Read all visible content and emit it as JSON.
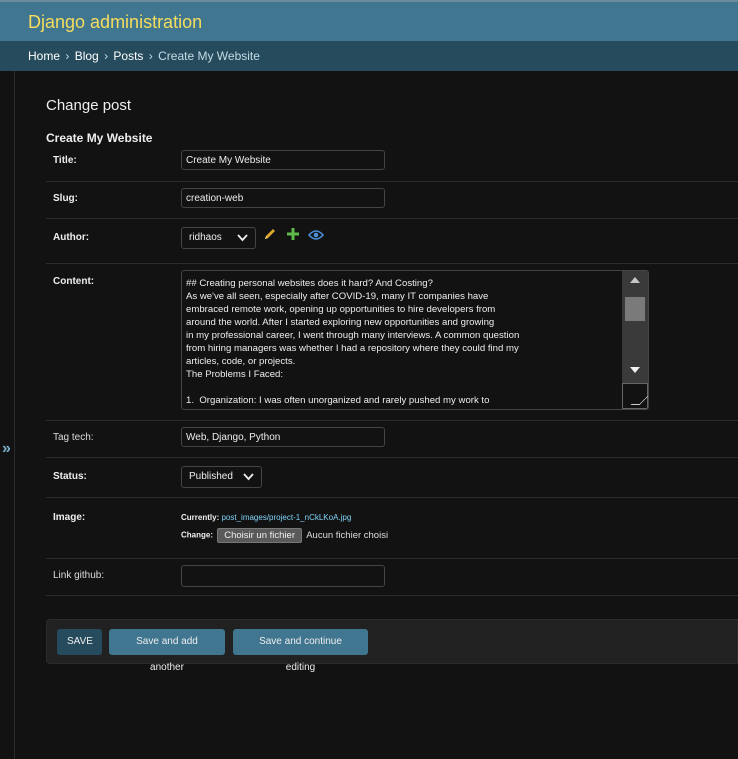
{
  "header": {
    "brand": "Django administration"
  },
  "breadcrumbs": {
    "home": "Home",
    "app": "Blog",
    "model": "Posts",
    "current": "Create My Website",
    "separator": "›"
  },
  "sidebar": {
    "toggle": "»"
  },
  "page": {
    "title": "Change post",
    "object_title": "Create My Website"
  },
  "fields": {
    "title": {
      "label": "Title:",
      "value": "Create My Website"
    },
    "slug": {
      "label": "Slug:",
      "value": "creation-web"
    },
    "author": {
      "label": "Author:",
      "selected": "ridhaos"
    },
    "content": {
      "label": "Content:",
      "value": "## Creating personal websites does it hard? And Costing?\nAs we've all seen, especially after COVID-19, many IT companies have\nembraced remote work, opening up opportunities to hire developers from\naround the world. After I started exploring new opportunities and growing\nin my professional career, I went through many interviews. A common question\nfrom hiring managers was whether I had a repository where they could find my\narticles, code, or projects.\nThe Problems I Faced:\n\n1.  Organization: I was often unorganized and rarely pushed my work to"
    },
    "tag_tech": {
      "label": "Tag tech:",
      "value": "Web, Django, Python"
    },
    "status": {
      "label": "Status:",
      "selected": "Published"
    },
    "image": {
      "label": "Image:",
      "currently_label": "Currently:",
      "current_file": "post_images/project-1_nCkLKoA.jpg",
      "change_label": "Change:",
      "choose_button": "Choisir un fichier",
      "no_file": "Aucun fichier choisi"
    },
    "link_github": {
      "label": "Link github:",
      "value": ""
    }
  },
  "actions": {
    "save": "SAVE",
    "save_add": "Save and add another",
    "save_continue": "Save and continue editing"
  },
  "colors": {
    "header_bg": "#417690",
    "brand": "#f5dd5d",
    "breadcrumbs_bg": "#264b5d",
    "body_bg": "#121212",
    "link": "#81d4fa"
  },
  "icons": {
    "edit": "pencil-icon",
    "add": "plus-icon",
    "view": "eye-icon",
    "chevron": "chevron-down-icon"
  }
}
